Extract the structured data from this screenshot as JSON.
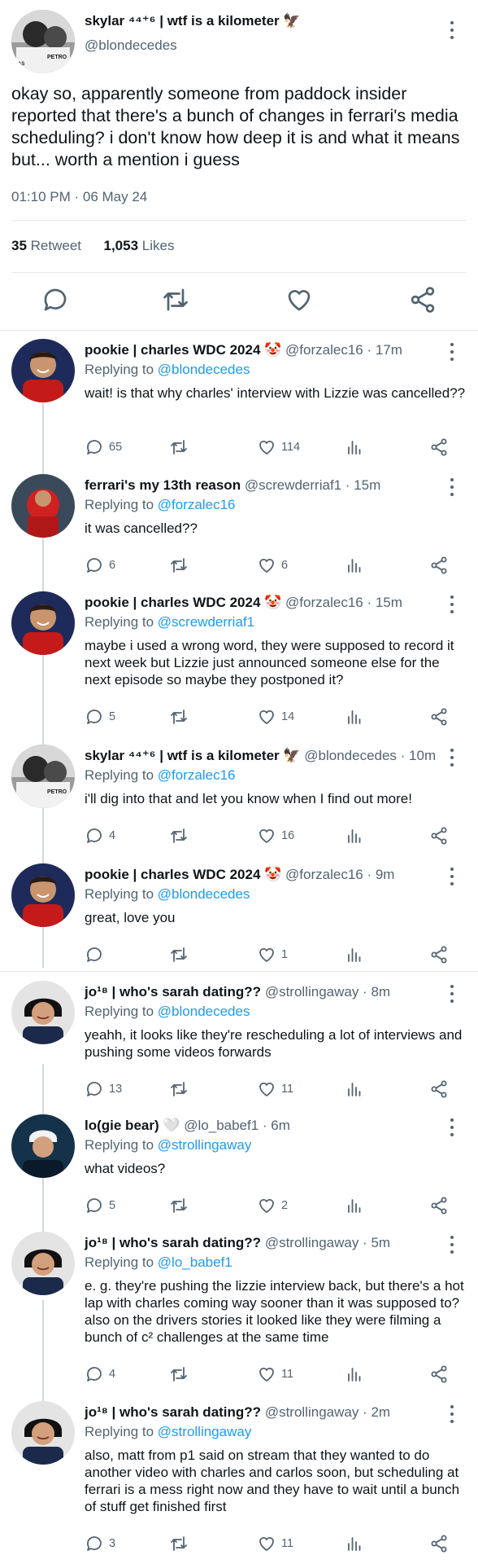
{
  "main_tweet": {
    "name": "skylar ⁴⁴⁺⁶ | wtf is a kilometer 🦅",
    "handle": "@blondecedes",
    "text": "okay so, apparently someone from paddock insider reported that there's a bunch of changes in ferrari's media scheduling? i don't know how deep it is and what it means but... worth a mention i guess",
    "timestamp": "01:10 PM · 06 May 24",
    "retweets_count": "35",
    "retweets_label": "Retweet",
    "likes_count": "1,053",
    "likes_label": "Likes",
    "actions": [
      "reply-icon",
      "retweet-icon",
      "like-icon",
      "share-icon"
    ]
  },
  "replies": [
    {
      "name": "pookie | charles WDC 2024 🤡",
      "meta": "@forzalec16 · 17m",
      "replying_label": "Replying to",
      "replying_to": "@blondecedes",
      "text": "wait! is that why charles' interview with Lizzie was cancelled??",
      "replies": "65",
      "likes": "114"
    },
    {
      "name": "ferrari's my 13th reason",
      "meta": "@screwderriaf1 · 15m",
      "replying_label": "Replying to",
      "replying_to": "@forzalec16",
      "text": "it was cancelled??",
      "replies": "6",
      "likes": "6"
    },
    {
      "name": "pookie | charles WDC 2024 🤡",
      "meta": "@forzalec16 · 15m",
      "replying_label": "Replying to",
      "replying_to": "@screwderriaf1",
      "text": "maybe i used a wrong word, they were supposed to record it next week but Lizzie just announced someone else for the next episode so maybe they postponed it?",
      "replies": "5",
      "likes": "14"
    },
    {
      "name": "skylar ⁴⁴⁺⁶ | wtf is a kilometer 🦅",
      "meta": "@blondecedes · 10m",
      "replying_label": "Replying to",
      "replying_to": "@forzalec16",
      "text": "i'll dig into that and let you know when I find out more!",
      "replies": "4",
      "likes": "16"
    },
    {
      "name": "pookie | charles WDC 2024 🤡",
      "meta": "@forzalec16 · 9m",
      "replying_label": "Replying to",
      "replying_to": "@blondecedes",
      "text": "great, love you",
      "replies": "",
      "likes": "1"
    },
    {
      "name": "jo¹⁸ | who's sarah dating??",
      "meta": "@strollingaway · 8m",
      "replying_label": "Replying to",
      "replying_to": "@blondecedes",
      "text": "yeahh, it looks like they're rescheduling a lot of interviews and pushing some videos forwards",
      "replies": "13",
      "likes": "11"
    },
    {
      "name": "lo(gie bear) 🤍",
      "meta": "@lo_babef1 · 6m",
      "replying_label": "Replying to",
      "replying_to": "@strollingaway",
      "text": "what videos?",
      "replies": "5",
      "likes": "2"
    },
    {
      "name": "jo¹⁸ | who's sarah dating??",
      "meta": "@strollingaway · 5m",
      "replying_label": "Replying to",
      "replying_to": "@lo_babef1",
      "text": "e. g. they're pushing the lizzie interview back, but there's a hot lap with charles coming way sooner than it was supposed to? also on the drivers stories it looked like they were filming a bunch of c² challenges at the same time",
      "replies": "4",
      "likes": "11"
    },
    {
      "name": "jo¹⁸ | who's sarah dating??",
      "meta": "@strollingaway · 2m",
      "replying_label": "Replying to",
      "replying_to": "@strollingaway",
      "text": "also, matt from p1 said on stream that they wanted to do another video with charles and carlos soon, but scheduling at ferrari is a mess right now and they have to wait until a bunch of stuff get finished first",
      "replies": "3",
      "likes": "11"
    }
  ],
  "colors": {
    "text": "#0f1419",
    "secondary": "#536471",
    "link": "#1d9bf0",
    "divider": "#e6e9eb",
    "thread_line": "#cfd9de"
  }
}
